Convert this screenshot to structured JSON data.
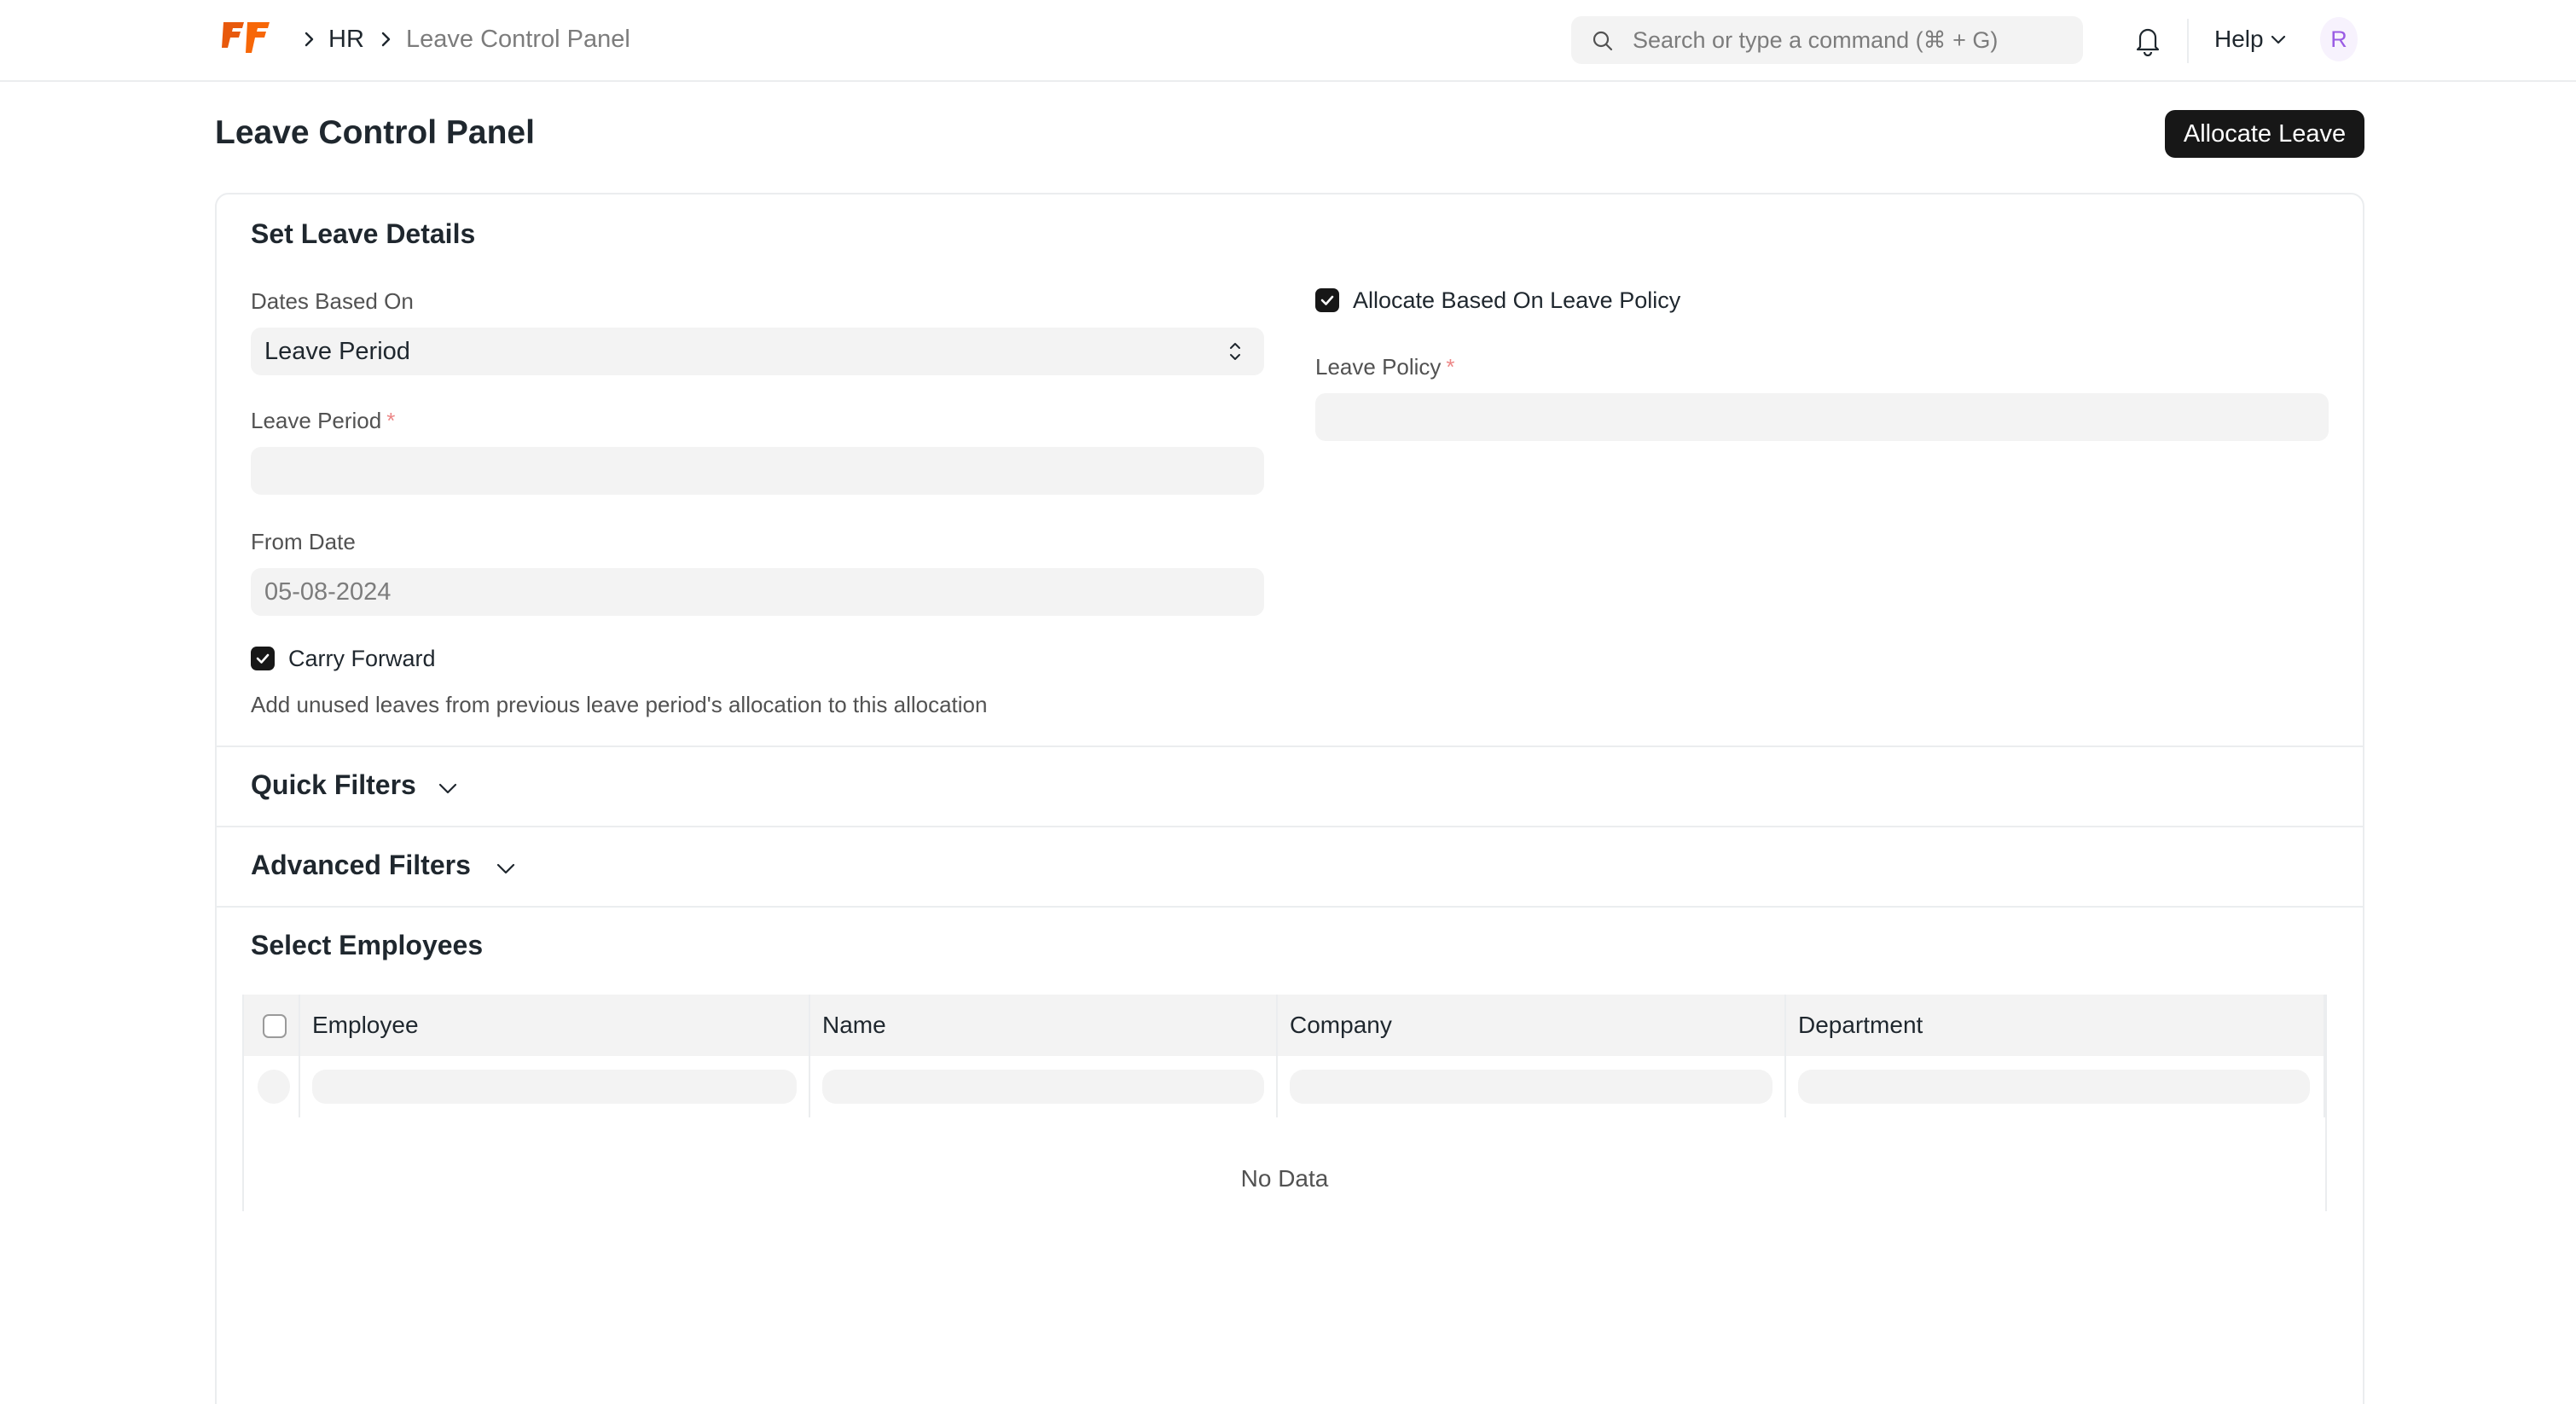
{
  "navbar": {
    "breadcrumbs": [
      "HR",
      "Leave Control Panel"
    ],
    "search_placeholder": "Search or type a command (⌘ + G)",
    "help_label": "Help",
    "avatar_initial": "R"
  },
  "page": {
    "title": "Leave Control Panel",
    "primary_action": "Allocate Leave"
  },
  "set_leave_details": {
    "title": "Set Leave Details",
    "dates_based_on": {
      "label": "Dates Based On",
      "value": "Leave Period"
    },
    "leave_period": {
      "label": "Leave Period",
      "value": ""
    },
    "from_date": {
      "label": "From Date",
      "value": "05-08-2024"
    },
    "carry_forward": {
      "label": "Carry Forward",
      "checked": true,
      "description": "Add unused leaves from previous leave period's allocation to this allocation"
    },
    "allocate_based_on_policy": {
      "label": "Allocate Based On Leave Policy",
      "checked": true
    },
    "leave_policy": {
      "label": "Leave Policy",
      "value": ""
    }
  },
  "sections": {
    "quick_filters": "Quick Filters",
    "advanced_filters": "Advanced Filters",
    "select_employees": "Select Employees"
  },
  "employees_table": {
    "columns": [
      "Employee",
      "Name",
      "Company",
      "Department"
    ],
    "empty_text": "No Data"
  },
  "colors": {
    "accent": "#171717",
    "logo_orange": "#e8590c",
    "avatar": "#9a5ce4",
    "field_bg": "#f3f3f3",
    "border": "#ebedef"
  }
}
